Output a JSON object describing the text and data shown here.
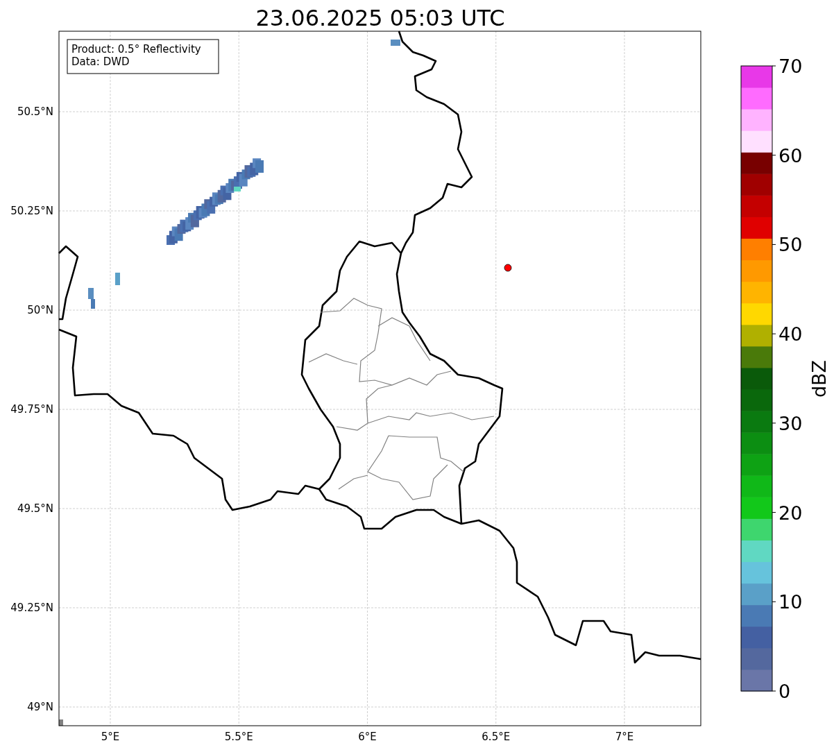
{
  "title": "23.06.2025 05:03 UTC",
  "info_box": {
    "lines": [
      "Product: 0.5° Reflectivity",
      "Data: DWD"
    ]
  },
  "map": {
    "lat_labels": [
      "50.5°N",
      "50.25°N",
      "50°N",
      "49.75°N",
      "49.5°N",
      "49.25°N",
      "49°N"
    ],
    "lon_labels": [
      "5°E",
      "5.5°E",
      "6°E",
      "6.5°E",
      "7°E"
    ]
  },
  "colorbar": {
    "label": "dBZ",
    "ticks": [
      "70",
      "60",
      "50",
      "40",
      "30",
      "20",
      "10",
      "0"
    ],
    "bands": [
      {
        "color": "#6a76a8"
      },
      {
        "color": "#54689e"
      },
      {
        "color": "#4460a2"
      },
      {
        "color": "#4a7ab4"
      },
      {
        "color": "#5aa0c8"
      },
      {
        "color": "#66c3dc"
      },
      {
        "color": "#60d8c2"
      },
      {
        "color": "#3ed66e"
      },
      {
        "color": "#12c81a"
      },
      {
        "color": "#10b818"
      },
      {
        "color": "#0ea214"
      },
      {
        "color": "#0c8e12"
      },
      {
        "color": "#0a7a10"
      },
      {
        "color": "#0a680c"
      },
      {
        "color": "#0a5a0a"
      },
      {
        "color": "#4a7a0a"
      },
      {
        "color": "#b0b000"
      },
      {
        "color": "#ffd800"
      },
      {
        "color": "#ffb400"
      },
      {
        "color": "#ff9900"
      },
      {
        "color": "#ff7f00"
      },
      {
        "color": "#e00000"
      },
      {
        "color": "#c40000"
      },
      {
        "color": "#a00000"
      },
      {
        "color": "#780000"
      },
      {
        "color": "#ffe0ff"
      },
      {
        "color": "#ffb3ff"
      },
      {
        "color": "#ff6bff"
      },
      {
        "color": "#e838e8"
      }
    ]
  }
}
